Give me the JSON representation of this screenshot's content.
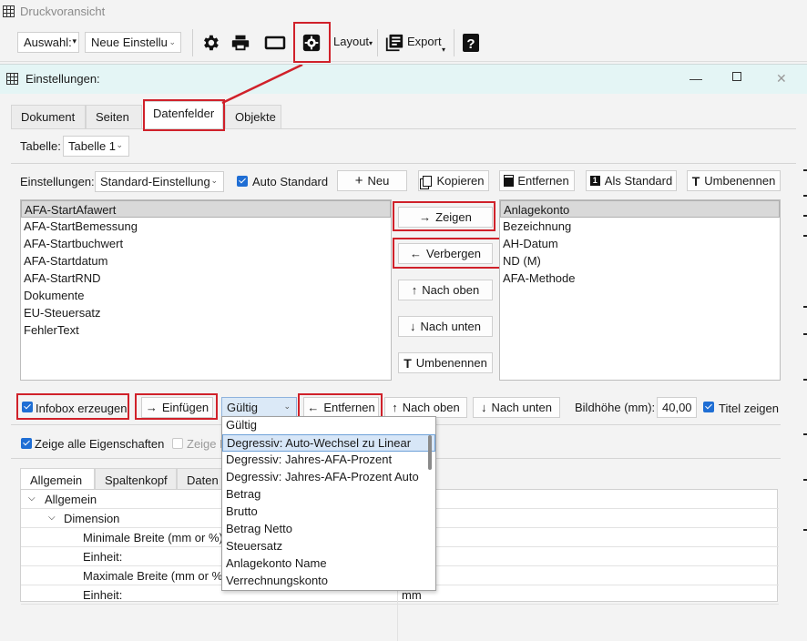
{
  "window": {
    "title": "Druckvoransicht"
  },
  "toolbar": {
    "select_label": "Auswahl:",
    "preset_value": "Neue Einstellu",
    "layout_label": "Layout",
    "export_label": "Export",
    "icons": [
      "gear-icon",
      "printer-icon",
      "frame-icon",
      "settings-gear-icon",
      "help-icon"
    ]
  },
  "dialog": {
    "title": "Einstellungen:",
    "tabs": [
      "Dokument",
      "Seiten",
      "Datenfelder",
      "Objekte"
    ],
    "active_tab": "Datenfelder",
    "table_label": "Tabelle:",
    "table_value": "Tabelle 1",
    "settings_label": "Einstellungen:",
    "settings_value": "Standard-Einstellung",
    "auto_standard": "Auto Standard",
    "buttons": {
      "neu": "Neu",
      "kopieren": "Kopieren",
      "entfernen": "Entfernen",
      "als_standard": "Als Standard",
      "umbenennen": "Umbenennen"
    },
    "available_fields": [
      "AFA-StartAfawert",
      "AFA-StartBemessung",
      "AFA-Startbuchwert",
      "AFA-Startdatum",
      "AFA-StartRND",
      "Dokumente",
      "EU-Steuersatz",
      "FehlerText"
    ],
    "shown_fields": [
      "Anlagekonto",
      "Bezeichnung",
      "AH-Datum",
      "ND (M)",
      "AFA-Methode"
    ],
    "middle_buttons": {
      "zeigen": "Zeigen",
      "verbergen": "Verbergen",
      "nach_oben": "Nach oben",
      "nach_unten": "Nach unten",
      "umbenennen": "Umbenennen"
    },
    "infobox": {
      "create": "Infobox erzeugen",
      "insert": "Einfügen",
      "combo_value": "Gültig",
      "remove": "Entfernen",
      "up": "Nach oben",
      "down": "Nach unten",
      "image_height_label": "Bildhöhe (mm):",
      "image_height_value": "40,00",
      "show_title": "Titel zeigen"
    },
    "show_all_props": "Zeige alle Eigenschaften",
    "show_b": "Zeige B",
    "dropdown_options": [
      "Gültig",
      "Degressiv: Auto-Wechsel zu Linear",
      "Degressiv: Jahres-AFA-Prozent",
      "Degressiv: Jahres-AFA-Prozent Auto",
      "Betrag",
      "Brutto",
      "Betrag Netto",
      "Steuersatz",
      "Anlagekonto Name",
      "Verrechnungskonto"
    ],
    "dropdown_highlighted": "Degressiv: Auto-Wechsel zu Linear",
    "prop_tabs": [
      "Allgemein",
      "Spaltenkopf",
      "Daten"
    ],
    "properties": [
      {
        "label": "Allgemein",
        "value": ""
      },
      {
        "label": "Dimension",
        "value": ""
      },
      {
        "label": "Minimale Breite (mm or %)",
        "value": ""
      },
      {
        "label": "Einheit:",
        "value": ""
      },
      {
        "label": "Maximale Breite (mm or %)",
        "value": ""
      },
      {
        "label": "Einheit:",
        "value": "mm"
      }
    ]
  }
}
